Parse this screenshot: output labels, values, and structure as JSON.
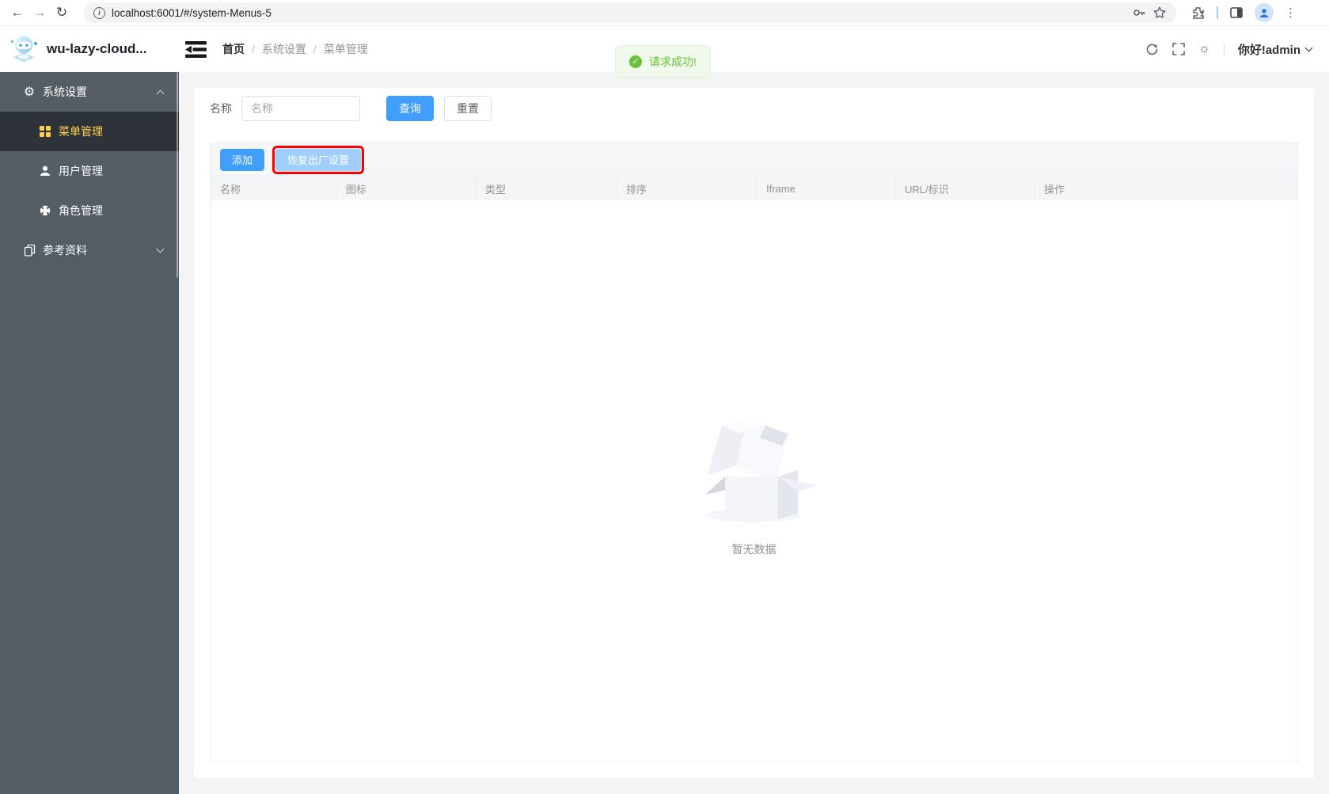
{
  "browser": {
    "url": "localhost:6001/#/system-Menus-5",
    "icons": [
      "back-icon",
      "forward-icon",
      "reload-icon",
      "info-icon",
      "key-icon",
      "bookmark-star-icon",
      "extensions-icon",
      "side-panel-icon",
      "profile-avatar-icon",
      "menu-kebab-icon"
    ]
  },
  "header": {
    "app_title": "wu-lazy-cloud...",
    "logo_icon": "robot-logo",
    "collapse_icon": "menu-fold-icon",
    "breadcrumb": {
      "home": "首页",
      "section": "系统设置",
      "current": "菜单管理",
      "separator": "/"
    },
    "actions": {
      "refresh_icon": "refresh-icon",
      "fullscreen_icon": "fullscreen-icon",
      "theme_icon": "sun-icon",
      "greeting": "你好!admin"
    }
  },
  "toast": {
    "text": "请求成功!",
    "status": "success",
    "color": "#67c23a",
    "background": "#f0f9eb"
  },
  "sidebar": {
    "groups": [
      {
        "label": "系统设置",
        "icon": "gear-icon",
        "expanded": true,
        "children": [
          {
            "label": "菜单管理",
            "icon": "grid-icon",
            "active": true
          },
          {
            "label": "用户管理",
            "icon": "user-icon",
            "active": false
          },
          {
            "label": "角色管理",
            "icon": "role-icon",
            "active": false
          }
        ]
      },
      {
        "label": "参考资料",
        "icon": "copy-document-icon",
        "expanded": false,
        "children": []
      }
    ],
    "colors": {
      "background": "#545c64",
      "active_background": "#2d3339",
      "active_text": "#ffd04b",
      "text": "#ffffff"
    }
  },
  "search": {
    "label": "名称",
    "placeholder": "名称",
    "value": "",
    "query_label": "查询",
    "reset_label": "重置"
  },
  "toolbar": {
    "add_label": "添加",
    "restore_label": "恢复出厂设置",
    "annotation_color": "#ff0000"
  },
  "table": {
    "columns": [
      "名称",
      "图标",
      "类型",
      "排序",
      "Iframe",
      "URL/标识",
      "操作"
    ],
    "rows": [],
    "empty_text": "暂无数据"
  },
  "colors": {
    "primary": "#409eff",
    "primary_light": "#a0cfff",
    "page_background": "#f4f4f5"
  }
}
